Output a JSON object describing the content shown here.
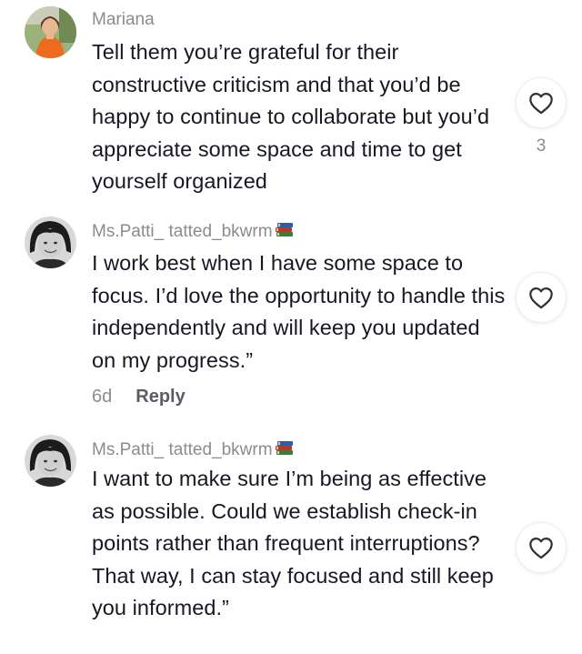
{
  "comments": [
    {
      "username": "Mariana",
      "text": "Tell them you’re grateful for their constructive criticism and that you’d be happy to continue to collaborate but you’d appreciate some space and time to get yourself organized",
      "like_count": "3",
      "has_emoji": false
    },
    {
      "username": "Ms.Patti_ tatted_bkwrm",
      "text": "I work best when I have some space to focus. I’d love the opportunity to handle this independently and will keep you updated on my progress.”",
      "time": "6d",
      "reply_label": "Reply",
      "has_emoji": true
    },
    {
      "username": "Ms.Patti_ tatted_bkwrm",
      "text": "I want to make sure I’m being as effective as possible. Could we establish check-in points rather than frequent interruptions? That way, I can stay focused and still keep you informed.”",
      "has_emoji": true
    }
  ],
  "icons": {
    "like": "heart-outline-icon",
    "emoji": "books-emoji-icon"
  },
  "colors": {
    "username": "#8a8b91",
    "text": "#161823",
    "meta": "#8a8b91"
  }
}
